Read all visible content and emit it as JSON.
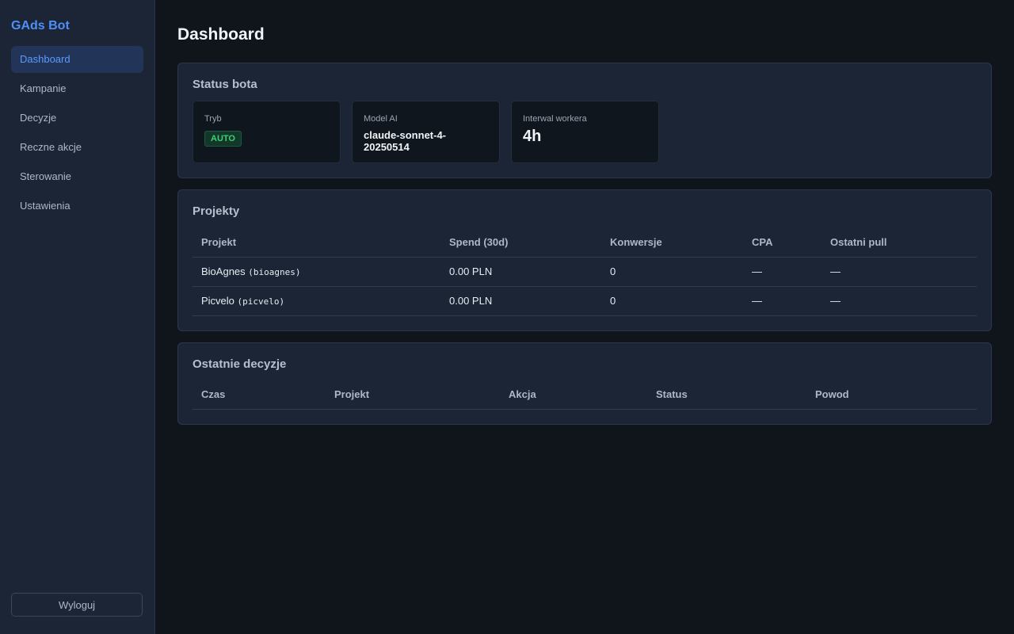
{
  "sidebar": {
    "brand": "GAds Bot",
    "items": [
      {
        "label": "Dashboard",
        "active": true
      },
      {
        "label": "Kampanie"
      },
      {
        "label": "Decyzje"
      },
      {
        "label": "Reczne akcje"
      },
      {
        "label": "Sterowanie"
      },
      {
        "label": "Ustawienia"
      }
    ],
    "logout_label": "Wyloguj"
  },
  "main": {
    "title": "Dashboard",
    "status": {
      "title": "Status bota",
      "mode_label": "Tryb",
      "mode_value": "AUTO",
      "model_label": "Model AI",
      "model_value": "claude-sonnet-4-20250514",
      "interval_label": "Interwal workera",
      "interval_value": "4h"
    },
    "projects": {
      "title": "Projekty",
      "columns": [
        "Projekt",
        "Spend (30d)",
        "Konwersje",
        "CPA",
        "Ostatni pull"
      ],
      "rows": [
        {
          "name": "BioAgnes",
          "slug": "(bioagnes)",
          "spend": "0.00 PLN",
          "conversions": "0",
          "cpa": "—",
          "last_pull": "—"
        },
        {
          "name": "Picvelo",
          "slug": "(picvelo)",
          "spend": "0.00 PLN",
          "conversions": "0",
          "cpa": "—",
          "last_pull": "—"
        }
      ]
    },
    "decisions": {
      "title": "Ostatnie decyzje",
      "columns": [
        "Czas",
        "Projekt",
        "Akcja",
        "Status",
        "Powod"
      ]
    }
  },
  "colors": {
    "accent": "#4f8ff7",
    "sidebar_bg": "#1b2536",
    "page_bg": "#10151b",
    "badge_green": "#3ecf74"
  }
}
